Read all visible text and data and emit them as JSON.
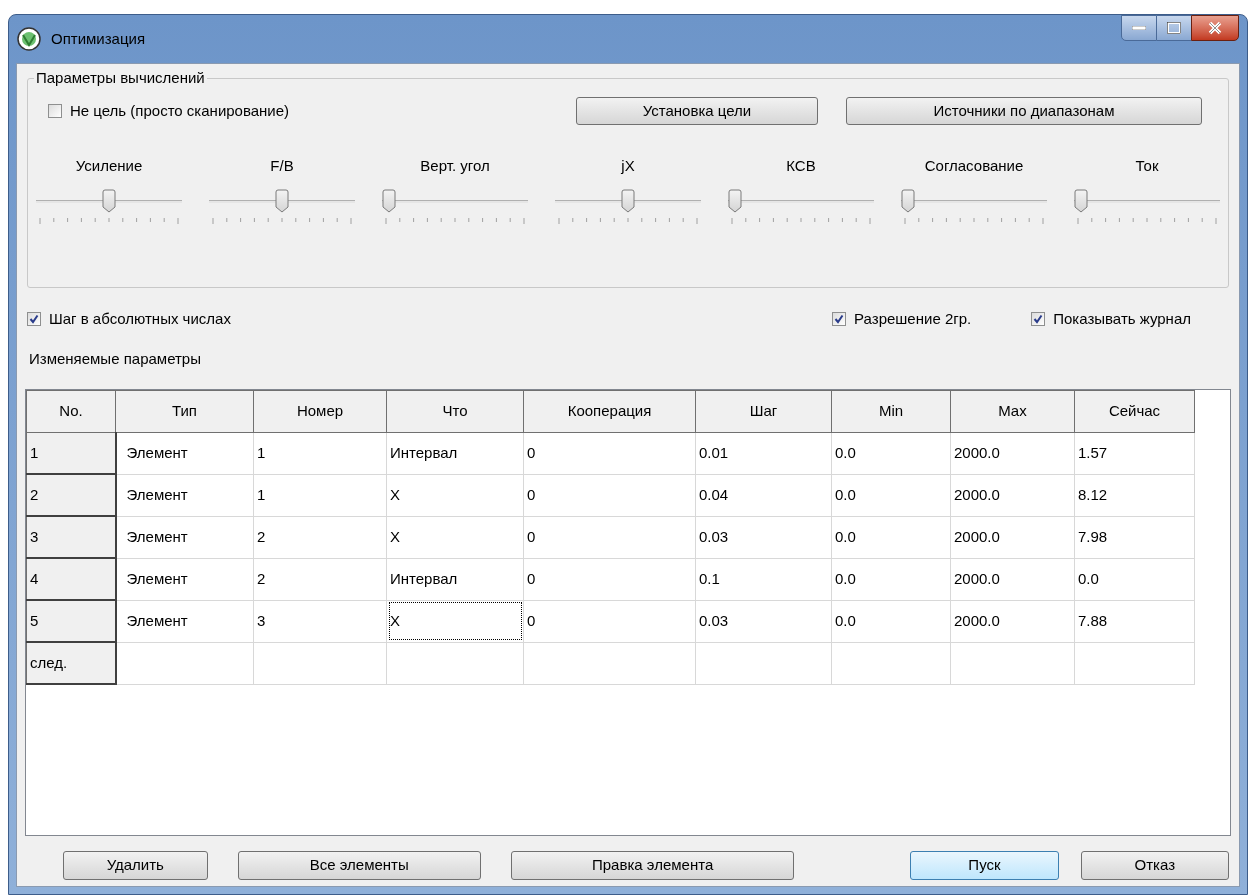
{
  "window": {
    "title": "Оптимизация"
  },
  "group": {
    "title": "Параметры вычислений",
    "no_target": {
      "label": "Не цель (просто сканирование)",
      "checked": false
    },
    "buttons": [
      "Установка цели",
      "Источники по диапазонам"
    ],
    "sliders": [
      {
        "label": "Усиление",
        "level": 0.5
      },
      {
        "label": "F/B",
        "level": 0.5
      },
      {
        "label": "Верт. угол",
        "level": 0
      },
      {
        "label": "jX",
        "level": 0.5
      },
      {
        "label": "КСВ",
        "level": 0
      },
      {
        "label": "Согласование",
        "level": 0
      },
      {
        "label": "Ток",
        "level": 0
      }
    ]
  },
  "options": [
    {
      "label": "Шаг в абсолютных числах",
      "checked": true
    },
    {
      "label": "Разрешение 2гр.",
      "checked": true
    },
    {
      "label": "Показывать журнал",
      "checked": true
    }
  ],
  "table": {
    "title": "Изменяемые параметры",
    "columns": [
      "No.",
      "Тип",
      "Номер",
      "Что",
      "Кооперация",
      "Шаг",
      "Min",
      "Max",
      "Сейчас"
    ],
    "rows": [
      {
        "cells": [
          {
            "text": "1",
            "focused": false
          },
          {
            "text": "Элемент",
            "focused": false
          },
          {
            "text": "1",
            "focused": false
          },
          {
            "text": "Интервал",
            "focused": false
          },
          {
            "text": "0",
            "focused": false
          },
          {
            "text": "0.01",
            "focused": false
          },
          {
            "text": "0.0",
            "focused": false
          },
          {
            "text": "2000.0",
            "focused": false
          },
          {
            "text": "1.57",
            "focused": false
          }
        ]
      },
      {
        "cells": [
          {
            "text": "2",
            "focused": false
          },
          {
            "text": "Элемент",
            "focused": false
          },
          {
            "text": "1",
            "focused": false
          },
          {
            "text": "X",
            "focused": false
          },
          {
            "text": "0",
            "focused": false
          },
          {
            "text": "0.04",
            "focused": false
          },
          {
            "text": "0.0",
            "focused": false
          },
          {
            "text": "2000.0",
            "focused": false
          },
          {
            "text": "8.12",
            "focused": false
          }
        ]
      },
      {
        "cells": [
          {
            "text": "3",
            "focused": false
          },
          {
            "text": "Элемент",
            "focused": false
          },
          {
            "text": "2",
            "focused": false
          },
          {
            "text": "X",
            "focused": false
          },
          {
            "text": "0",
            "focused": false
          },
          {
            "text": "0.03",
            "focused": false
          },
          {
            "text": "0.0",
            "focused": false
          },
          {
            "text": "2000.0",
            "focused": false
          },
          {
            "text": "7.98",
            "focused": false
          }
        ]
      },
      {
        "cells": [
          {
            "text": "4",
            "focused": false
          },
          {
            "text": "Элемент",
            "focused": false
          },
          {
            "text": "2",
            "focused": false
          },
          {
            "text": "Интервал",
            "focused": false
          },
          {
            "text": "0",
            "focused": false
          },
          {
            "text": "0.1",
            "focused": false
          },
          {
            "text": "0.0",
            "focused": false
          },
          {
            "text": "2000.0",
            "focused": false
          },
          {
            "text": "0.0",
            "focused": false
          }
        ]
      },
      {
        "cells": [
          {
            "text": "5",
            "focused": false
          },
          {
            "text": "Элемент",
            "focused": false
          },
          {
            "text": "3",
            "focused": false
          },
          {
            "text": "X",
            "focused": true
          },
          {
            "text": "0",
            "focused": false
          },
          {
            "text": "0.03",
            "focused": false
          },
          {
            "text": "0.0",
            "focused": false
          },
          {
            "text": "2000.0",
            "focused": false
          },
          {
            "text": "7.88",
            "focused": false
          }
        ]
      },
      {
        "cells": [
          {
            "text": "след.",
            "focused": false
          }
        ]
      }
    ]
  },
  "buttons": [
    {
      "label": "Удалить",
      "default": false
    },
    {
      "label": "Все элементы",
      "default": false
    },
    {
      "label": "Правка элемента",
      "default": false
    },
    {
      "label": "Пуск",
      "default": true
    },
    {
      "label": "Отказ",
      "default": false
    }
  ]
}
